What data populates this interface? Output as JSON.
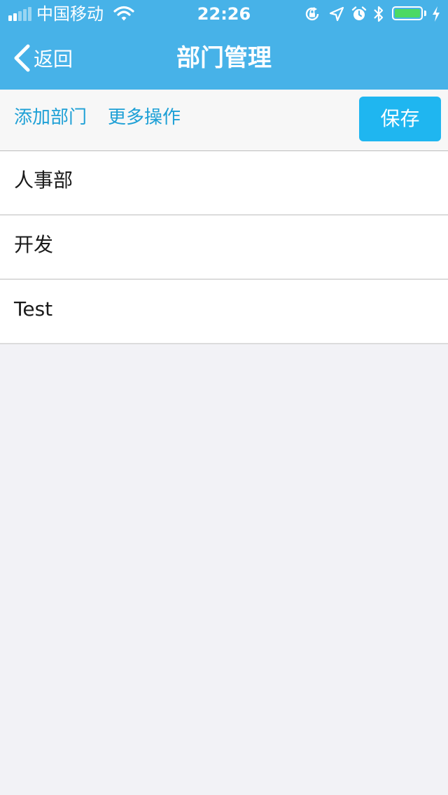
{
  "status_bar": {
    "carrier": "中国移动",
    "time": "22:26",
    "battery_level": 1.0
  },
  "nav": {
    "back_label": "返回",
    "title": "部门管理"
  },
  "toolbar": {
    "add_label": "添加部门",
    "more_label": "更多操作",
    "save_label": "保存"
  },
  "departments": [
    {
      "name": "人事部"
    },
    {
      "name": "开发"
    },
    {
      "name": "Test"
    }
  ],
  "colors": {
    "header_bg": "#47b2e8",
    "accent_link": "#1ea0d6",
    "save_button_bg": "#1fb6f0",
    "battery_fill": "#4cd964",
    "page_bg": "#f2f2f6"
  },
  "icons": [
    "signal-icon",
    "wifi-icon",
    "orientation-lock-icon",
    "location-arrow-icon",
    "alarm-icon",
    "bluetooth-icon",
    "battery-icon",
    "charging-icon",
    "chevron-left-icon"
  ]
}
